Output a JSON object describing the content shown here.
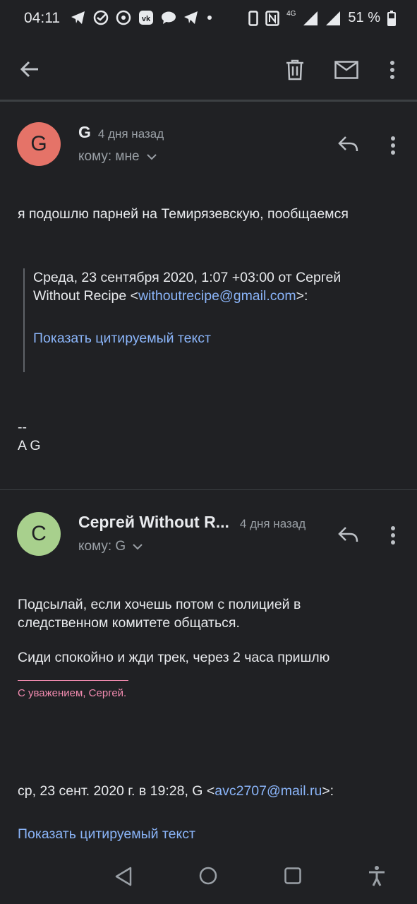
{
  "status": {
    "time": "04:11",
    "network": "4G",
    "battery": "51 %"
  },
  "toolbar": {
    "back": "back-icon",
    "delete": "delete-icon",
    "mark_unread": "mail-icon",
    "more": "more-vert-icon"
  },
  "messages": [
    {
      "avatar_letter": "G",
      "avatar_color": "#e57368",
      "sender": "G",
      "time": "4 дня назад",
      "recipient": "кому: мне",
      "body": "я подошлю парней на Темирязевскую, пообщаемся",
      "quote_header_pre": "Среда, 23 сентября 2020, 1:07 +03:00 от Сергей Without Recipe <",
      "quote_email": "withoutrecipe@gmail.com",
      "quote_header_post": ">:",
      "show_quoted": "Показать цитируемый текст",
      "sig_dashes": "--",
      "sig_name": "A G"
    },
    {
      "avatar_letter": "C",
      "avatar_color": "#a8d08d",
      "sender": "Сергей Without R...",
      "time": "4 дня назад",
      "recipient": "кому: G",
      "body_line1": "Подсылай, если хочешь потом с полицией в",
      "body_line2": "следственном комитете общаться.",
      "body_line3": "Сиди спокойно и жди трек, через 2 часа пришлю",
      "signature": "С уважением, Сергей.",
      "reply_header_pre": "ср, 23 сент. 2020 г. в 19:28, G <",
      "reply_email": "avc2707@mail.ru",
      "reply_header_post": ">:",
      "show_quoted": "Показать цитируемый текст"
    }
  ],
  "navbar": {
    "back": "nav-back-icon",
    "home": "nav-home-icon",
    "recents": "nav-recents-icon",
    "accessibility": "accessibility-icon"
  }
}
